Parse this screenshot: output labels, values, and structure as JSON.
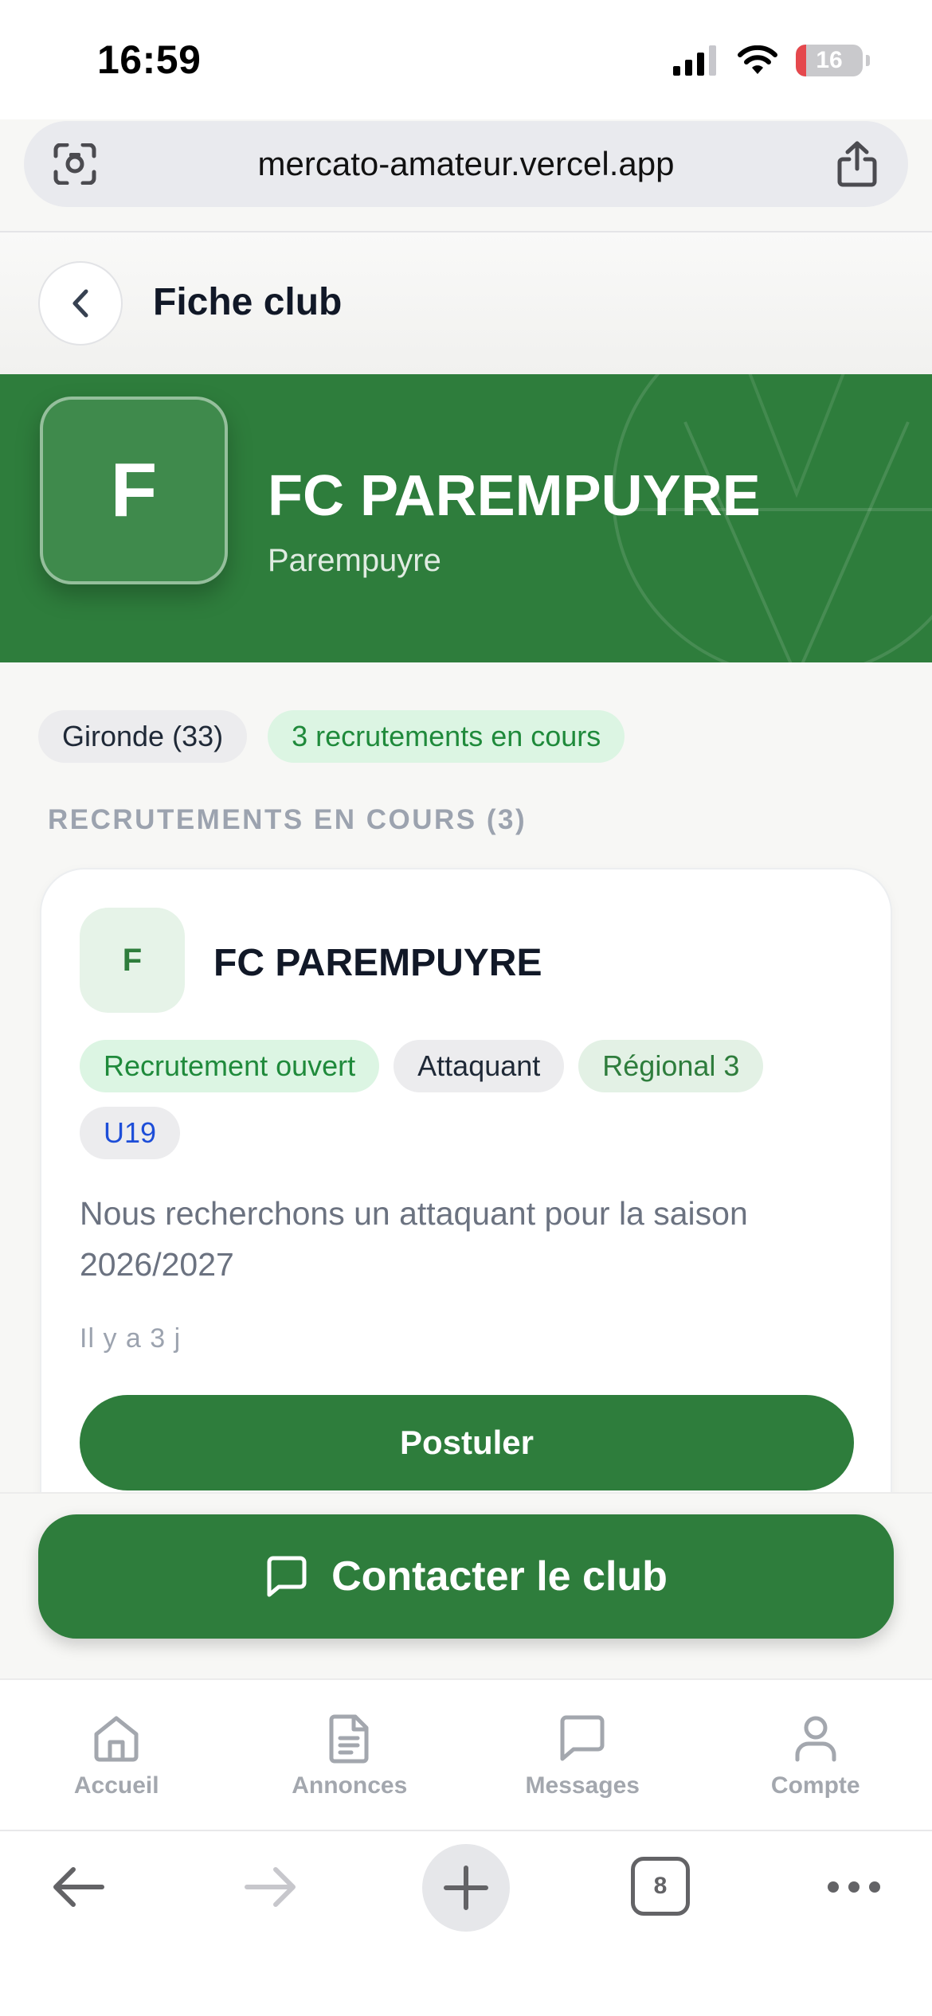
{
  "status_bar": {
    "time": "16:59",
    "battery": "16",
    "battery_level": 0.16
  },
  "browser": {
    "url": "mercato-amateur.vercel.app",
    "tab_count": "8"
  },
  "header": {
    "title": "Fiche club"
  },
  "club": {
    "logo_letter": "F",
    "name": "FC PAREMPUYRE",
    "city": "Parempuyre",
    "chips": {
      "department": "Gironde (33)",
      "recruitments": "3 recrutements en cours"
    }
  },
  "section": {
    "label": "RECRUTEMENTS EN COURS (3)"
  },
  "recruitment": {
    "logo_letter": "F",
    "club_name": "FC PAREMPUYRE",
    "tags": {
      "status": "Recrutement ouvert",
      "position": "Attaquant",
      "level": "Régional 3",
      "age": "U19"
    },
    "description": "Nous recherchons un attaquant pour la saison 2026/2027",
    "posted": "Il y a 3 j",
    "apply_label": "Postuler"
  },
  "contact": {
    "label": "Contacter le club"
  },
  "bottom_nav": {
    "home": "Accueil",
    "ads": "Annonces",
    "messages": "Messages",
    "account": "Compte"
  },
  "colors": {
    "brand_green": "#2e7d3c",
    "chip_green_bg": "#dcf5e3",
    "chip_green_text": "#1f8a3b",
    "age_blue": "#1d4ed8"
  }
}
